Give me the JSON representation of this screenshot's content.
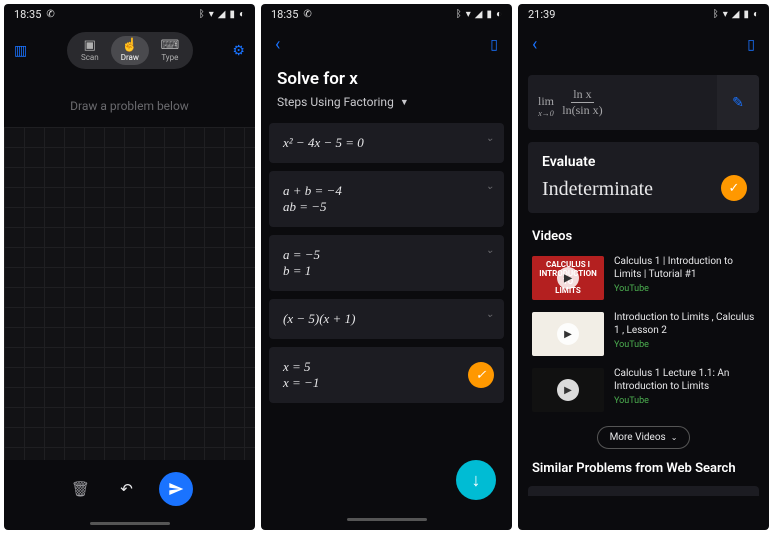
{
  "screen1": {
    "status": {
      "time": "18:35",
      "icons_left": [
        "whatsapp"
      ],
      "icons_right": [
        "bluetooth",
        "wifi",
        "signal",
        "battery",
        "circle"
      ]
    },
    "modes": {
      "scan": "Scan",
      "draw": "Draw",
      "type": "Type",
      "active": "draw"
    },
    "hint": "Draw a problem below"
  },
  "screen2": {
    "status": {
      "time": "18:35"
    },
    "title": "Solve for x",
    "method": "Steps Using Factoring",
    "steps": [
      {
        "eq": "x² − 4x − 5 = 0"
      },
      {
        "eq": "a + b = −4\nab = −5"
      },
      {
        "eq": "a = −5\nb = 1"
      },
      {
        "eq": "(x − 5)(x + 1)"
      },
      {
        "eq": "x = 5\nx = −1",
        "final": true
      }
    ]
  },
  "screen3": {
    "status": {
      "time": "21:39"
    },
    "expression": {
      "lim_sub": "x→0",
      "num": "ln x",
      "den": "ln(sin x)"
    },
    "result": {
      "heading": "Evaluate",
      "value": "Indeterminate"
    },
    "videos_header": "Videos",
    "videos": [
      {
        "title": "Calculus 1 | Introduction to Limits | Tutorial #1",
        "source": "YouTube",
        "thumb_text": "CALCULUS I\nINTRODUCTION TO\nLIMITS"
      },
      {
        "title": "Introduction to Limits , Calculus 1 , Lesson 2",
        "source": "YouTube"
      },
      {
        "title": "Calculus 1 Lecture 1.1: An Introduction to Limits",
        "source": "YouTube"
      }
    ],
    "more_videos": "More Videos",
    "similar_header": "Similar Problems from Web Search"
  },
  "colors": {
    "accent_blue": "#1a73ff",
    "accent_orange": "#ff9800",
    "accent_teal": "#00bcd4",
    "source_green": "#4caf50"
  }
}
